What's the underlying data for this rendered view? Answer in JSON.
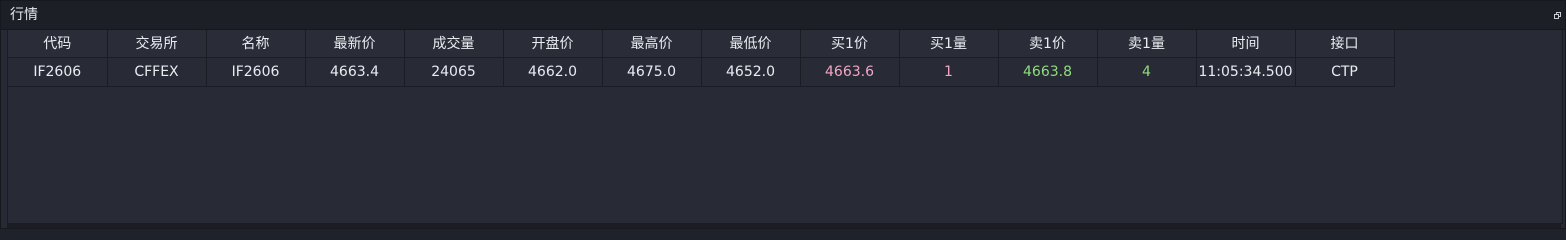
{
  "panel": {
    "title": "行情"
  },
  "table": {
    "headers": [
      "代码",
      "交易所",
      "名称",
      "最新价",
      "成交量",
      "开盘价",
      "最高价",
      "最低价",
      "买1价",
      "买1量",
      "卖1价",
      "卖1量",
      "时间",
      "接口"
    ],
    "rows": [
      [
        "IF2606",
        "CFFEX",
        "IF2606",
        "4663.4",
        "24065",
        "4662.0",
        "4675.0",
        "4652.0",
        "4663.6",
        "1",
        "4663.8",
        "4",
        "11:05:34.500",
        "CTP"
      ]
    ]
  },
  "colors": {
    "bid": "#f2a6c2",
    "ask": "#8fdc7f",
    "background": "#272a34",
    "text": "#e9ebf0"
  },
  "icons": {
    "dock": "float-window-icon"
  }
}
